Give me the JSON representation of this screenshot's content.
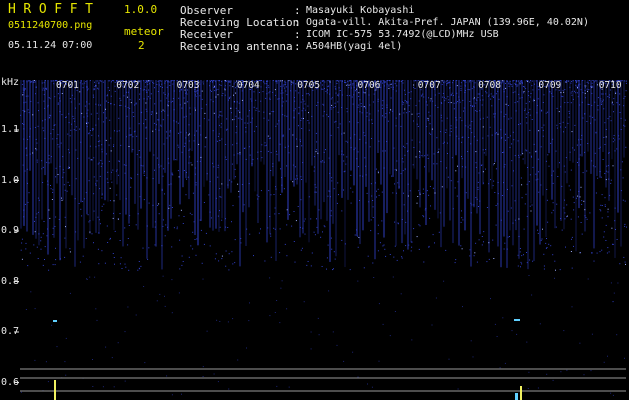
{
  "header": {
    "app_title": "HROFFT",
    "app_version": "1.0.0",
    "file_name": "0511240700.png",
    "timestamp": "05.11.24 07:00",
    "detect_label": "meteor",
    "detect_count": "2"
  },
  "station_info": [
    {
      "label": "Observer",
      "value": "Masayuki Kobayashi"
    },
    {
      "label": "Receiving Location",
      "value": "Ogata-vill. Akita-Pref. JAPAN (139.96E, 40.02N)"
    },
    {
      "label": "Receiver",
      "value": "ICOM IC-575 53.7492(@LCD)MHz USB"
    },
    {
      "label": "Receiving antenna",
      "value": "A504HB(yagi 4el)"
    }
  ],
  "spectrogram": {
    "unit_label": "kHz",
    "time_ticks": [
      "0701",
      "0702",
      "0703",
      "0704",
      "0705",
      "0706",
      "0707",
      "0708",
      "0709",
      "0710"
    ],
    "freq_ticks": [
      "1.1",
      "1.0",
      "0.9",
      "0.8",
      "0.7",
      "0.6"
    ],
    "colors": {
      "noise": "#3040c8",
      "bright": "#a0b0ff",
      "meteor": "#f0f060",
      "echo": "#60d0ff",
      "line": "#9a9a9a",
      "text": "#e6e600"
    }
  }
}
